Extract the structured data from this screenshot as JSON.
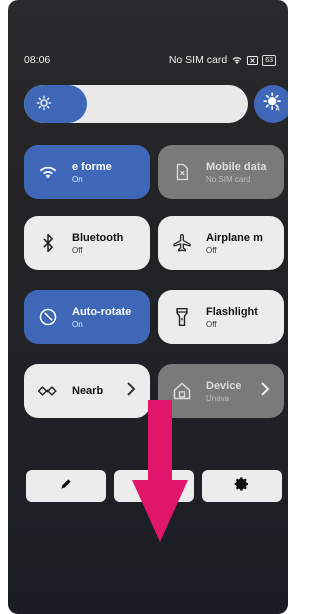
{
  "status": {
    "time": "08:06",
    "carrier": "No SIM card",
    "battery": "63"
  },
  "brightness": {
    "level_percent": 28
  },
  "tiles": [
    {
      "name": "e forme",
      "state": "On",
      "style": "on",
      "icon": "wifi-icon"
    },
    {
      "name": "Mobile data",
      "state": "No SIM card",
      "style": "disabled",
      "icon": "sim-icon"
    },
    {
      "name": "Bluetooth",
      "state": "Off",
      "style": "off",
      "icon": "bluetooth-icon"
    },
    {
      "name": "Airplane m",
      "state": "Off",
      "style": "off",
      "icon": "airplane-icon"
    },
    {
      "name": "Auto-rotate",
      "state": "On",
      "style": "on",
      "icon": "rotate-icon"
    },
    {
      "name": "Flashlight",
      "state": "Off",
      "style": "off",
      "icon": "flashlight-icon"
    },
    {
      "name": "Nearb",
      "state": "",
      "style": "off",
      "icon": "nearby-share-icon"
    },
    {
      "name": "Device",
      "state": "Unava",
      "style": "disabled",
      "icon": "home-icon"
    }
  ],
  "colors": {
    "accent": "#3f67b8",
    "tile_off": "#ececec",
    "tile_disabled": "#7a7a7a",
    "arrow": "#e0166b"
  },
  "bottom_buttons": [
    {
      "icon": "edit-pencil-icon"
    },
    {
      "icon": "blank"
    },
    {
      "icon": "settings-gear-icon"
    }
  ]
}
